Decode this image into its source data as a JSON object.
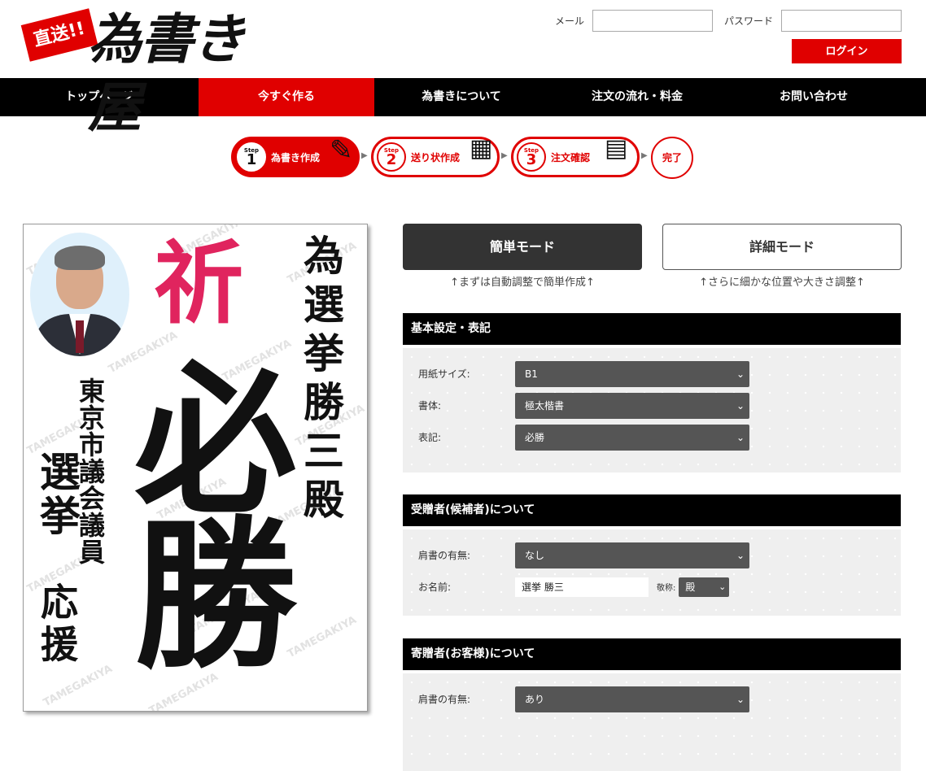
{
  "logo": {
    "badge": "直送!!",
    "name": "為書き屋"
  },
  "login": {
    "email_label": "メール",
    "password_label": "パスワード",
    "button": "ログイン"
  },
  "nav": [
    {
      "label": "トップページ",
      "active": false
    },
    {
      "label": "今すぐ作る",
      "active": true
    },
    {
      "label": "為書きについて",
      "active": false
    },
    {
      "label": "注文の流れ・料金",
      "active": false
    },
    {
      "label": "お問い合わせ",
      "active": false
    }
  ],
  "steps": [
    {
      "tag": "Step",
      "num": "1",
      "label": "為書き作成",
      "icon": "brush-icon"
    },
    {
      "tag": "Step",
      "num": "2",
      "label": "送り状作成",
      "icon": "phone-icon"
    },
    {
      "tag": "Step",
      "num": "3",
      "label": "注文確認",
      "icon": "document-icon"
    }
  ],
  "done": "完了",
  "preview": {
    "watermark": "TAMEGAKIYA",
    "inori": "祈",
    "main": "必勝",
    "right": "為選挙勝三殿",
    "left1": "東京市議会議員",
    "left2": "選挙",
    "left3": "応援"
  },
  "modes": {
    "simple": "簡単モード",
    "simple_note": "↑まずは自動調整で簡単作成↑",
    "detail": "詳細モード",
    "detail_note": "↑さらに細かな位置や大きさ調整↑"
  },
  "sections": {
    "basic": {
      "title": "基本設定・表記",
      "paper_label": "用紙サイズ:",
      "paper_value": "B1",
      "font_label": "書体:",
      "font_value": "極太楷書",
      "notation_label": "表記:",
      "notation_value": "必勝"
    },
    "recipient": {
      "title": "受贈者(候補者)について",
      "title_label": "肩書の有無:",
      "title_value": "なし",
      "name_label": "お名前:",
      "name_value": "選挙 勝三",
      "honorific_label": "敬称:",
      "honorific_value": "殿"
    },
    "sender": {
      "title": "寄贈者(お客様)について",
      "title_label": "肩書の有無:",
      "title_value": "あり"
    }
  }
}
